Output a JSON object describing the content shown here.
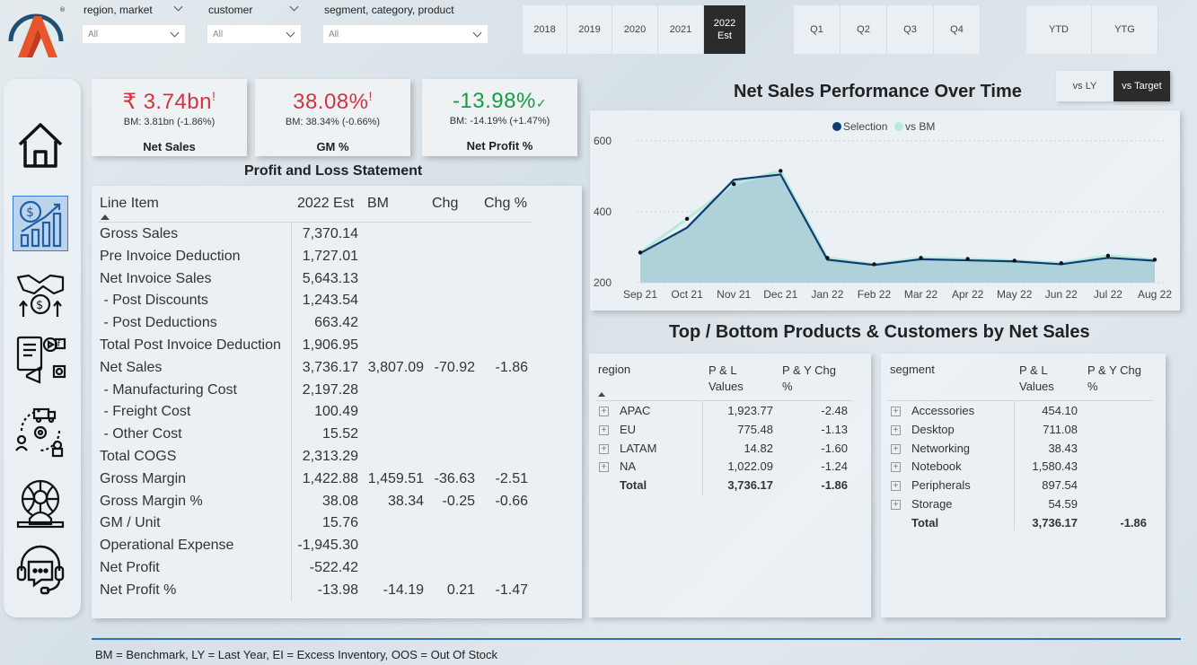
{
  "filters": [
    {
      "label": "region, market",
      "value": "All"
    },
    {
      "label": "customer",
      "value": "All"
    },
    {
      "label": "segment, category, product",
      "value": "All"
    }
  ],
  "years": [
    "2018",
    "2019",
    "2020",
    "2021",
    "2022 Est"
  ],
  "active_year": "2022 Est",
  "quarters": [
    "Q1",
    "Q2",
    "Q3",
    "Q4"
  ],
  "periods": [
    "YTD",
    "YTG"
  ],
  "kpis": [
    {
      "value": "₹ 3.74bn",
      "flag": "!",
      "bm": "BM: 3.81bn (-1.86%)",
      "name": "Net Sales",
      "status": "bad"
    },
    {
      "value": "38.08%",
      "flag": "!",
      "bm": "BM: 38.34% (-0.66%)",
      "name": "GM %",
      "status": "bad"
    },
    {
      "value": "-13.98%",
      "flag": "✓",
      "bm": "BM: -14.19% (+1.47%)",
      "name": "Net Profit %",
      "status": "good"
    }
  ],
  "colors": {
    "bad": "#d2343f",
    "good": "#1a9a45",
    "area": "#a9cdd6",
    "line": "#0f3d73",
    "bm_line": "#b8ead8"
  },
  "pl": {
    "title": "Profit and Loss Statement",
    "headers": [
      "Line Item",
      "2022 Est",
      "BM",
      "Chg",
      "Chg %"
    ],
    "rows": [
      {
        "item": "Gross Sales",
        "est": "7,370.14",
        "bm": "",
        "chg": "",
        "chgp": ""
      },
      {
        "item": "Pre Invoice Deduction",
        "est": "1,727.01",
        "bm": "",
        "chg": "",
        "chgp": ""
      },
      {
        "item": "Net Invoice Sales",
        "est": "5,643.13",
        "bm": "",
        "chg": "",
        "chgp": ""
      },
      {
        "item": " - Post Discounts",
        "est": "1,243.54",
        "bm": "",
        "chg": "",
        "chgp": ""
      },
      {
        "item": " - Post Deductions",
        "est": "663.42",
        "bm": "",
        "chg": "",
        "chgp": ""
      },
      {
        "item": "Total Post Invoice Deduction",
        "est": "1,906.95",
        "bm": "",
        "chg": "",
        "chgp": ""
      },
      {
        "item": "Net Sales",
        "est": "3,736.17",
        "bm": "3,807.09",
        "chg": "-70.92",
        "chgp": "-1.86"
      },
      {
        "item": " - Manufacturing Cost",
        "est": "2,197.28",
        "bm": "",
        "chg": "",
        "chgp": ""
      },
      {
        "item": " - Freight Cost",
        "est": "100.49",
        "bm": "",
        "chg": "",
        "chgp": ""
      },
      {
        "item": " - Other Cost",
        "est": "15.52",
        "bm": "",
        "chg": "",
        "chgp": ""
      },
      {
        "item": "Total COGS",
        "est": "2,313.29",
        "bm": "",
        "chg": "",
        "chgp": ""
      },
      {
        "item": "Gross Margin",
        "est": "1,422.88",
        "bm": "1,459.51",
        "chg": "-36.63",
        "chgp": "-2.51"
      },
      {
        "item": "Gross Margin %",
        "est": "38.08",
        "bm": "38.34",
        "chg": "-0.25",
        "chgp": "-0.66"
      },
      {
        "item": "GM / Unit",
        "est": "15.76",
        "bm": "",
        "chg": "",
        "chgp": ""
      },
      {
        "item": "Operational Expense",
        "est": "-1,945.30",
        "bm": "",
        "chg": "",
        "chgp": ""
      },
      {
        "item": "Net Profit",
        "est": "-522.42",
        "bm": "",
        "chg": "",
        "chgp": ""
      },
      {
        "item": "Net Profit %",
        "est": "-13.98",
        "bm": "-14.19",
        "chg": "0.21",
        "chgp": "-1.47"
      }
    ]
  },
  "performance": {
    "title": "Net Sales Performance Over Time",
    "toggle": [
      "vs LY",
      "vs Target"
    ],
    "active_toggle": "vs Target"
  },
  "chart_data": {
    "type": "area",
    "x": [
      "Sep 21",
      "Oct 21",
      "Nov 21",
      "Dec 21",
      "Jan 22",
      "Feb 22",
      "Mar 22",
      "Apr 22",
      "May 22",
      "Jun 22",
      "Jul 22",
      "Aug 22"
    ],
    "series": [
      {
        "name": "Selection",
        "values": [
          283,
          355,
          490,
          505,
          265,
          250,
          266,
          263,
          260,
          252,
          270,
          262
        ]
      },
      {
        "name": "vs BM",
        "values": [
          285,
          380,
          478,
          515,
          270,
          252,
          270,
          267,
          262,
          255,
          276,
          265
        ]
      }
    ],
    "yticks": [
      200,
      400,
      600
    ],
    "ylim": [
      200,
      640
    ],
    "legend": "top-center"
  },
  "topbottom": {
    "title": "Top / Bottom Products & Customers by Net Sales",
    "region": {
      "headers": [
        "region",
        "P & L Values",
        "P & Y Chg %"
      ],
      "rows": [
        {
          "name": "APAC",
          "val": "1,923.77",
          "chg": "-2.48"
        },
        {
          "name": "EU",
          "val": "775.48",
          "chg": "-1.13"
        },
        {
          "name": "LATAM",
          "val": "14.82",
          "chg": "-1.60"
        },
        {
          "name": "NA",
          "val": "1,022.09",
          "chg": "-1.24"
        }
      ],
      "total": {
        "name": "Total",
        "val": "3,736.17",
        "chg": "-1.86"
      }
    },
    "segment": {
      "headers": [
        "segment",
        "P & L Values",
        "P & Y Chg %"
      ],
      "rows": [
        {
          "name": "Accessories",
          "val": "454.10",
          "chg": ""
        },
        {
          "name": "Desktop",
          "val": "711.08",
          "chg": ""
        },
        {
          "name": "Networking",
          "val": "38.43",
          "chg": ""
        },
        {
          "name": "Notebook",
          "val": "1,580.43",
          "chg": ""
        },
        {
          "name": "Peripherals",
          "val": "897.54",
          "chg": ""
        },
        {
          "name": "Storage",
          "val": "54.59",
          "chg": ""
        }
      ],
      "total": {
        "name": "Total",
        "val": "3,736.17",
        "chg": "-1.86"
      }
    }
  },
  "footer": "BM = Benchmark, LY = Last Year, EI = Excess Inventory, OOS = Out Of Stock",
  "sidebar": [
    "home-icon",
    "finance-view-icon",
    "sales-view-icon",
    "marketing-view-icon",
    "supply-chain-icon",
    "executive-view-icon",
    "support-icon"
  ]
}
